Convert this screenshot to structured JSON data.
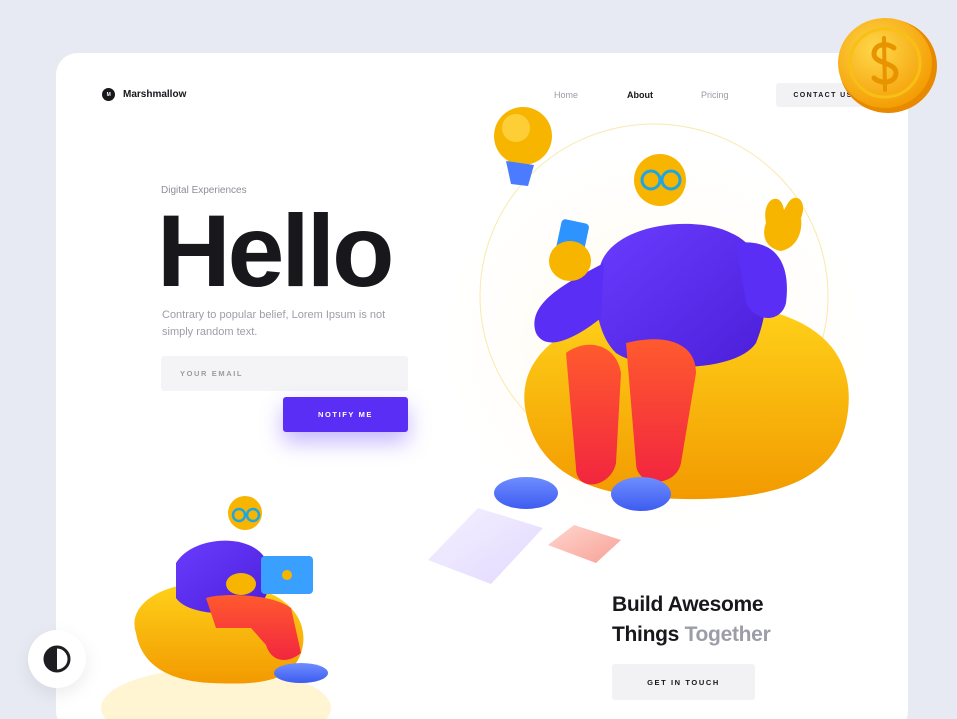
{
  "brand": {
    "logo_mark": "M",
    "name": "Marshmallow"
  },
  "nav": {
    "items": [
      {
        "label": "Home"
      },
      {
        "label": "About"
      },
      {
        "label": "Pricing"
      }
    ],
    "active": "About",
    "contact_label": "CONTACT US"
  },
  "hero": {
    "eyebrow": "Digital Experiences",
    "title": "Hello",
    "subtitle": "Contrary to popular belief, Lorem Ipsum is not simply random text.",
    "email_placeholder": "YOUR EMAIL",
    "notify_label": "NOTIFY ME"
  },
  "cta": {
    "line1": "Build Awesome",
    "line2_main": "Things ",
    "line2_accent": "Together",
    "button_label": "GET IN TOUCH"
  },
  "icons": {
    "coin": "dollar-coin-icon",
    "theme_toggle": "half-circle-contrast-icon"
  },
  "colors": {
    "primary": "#5a2ef5",
    "dark": "#17171c",
    "muted": "#9d9da8",
    "yellow": "#f7b500",
    "orange_red": "#f24a2a",
    "background": "#e8eaf3"
  }
}
